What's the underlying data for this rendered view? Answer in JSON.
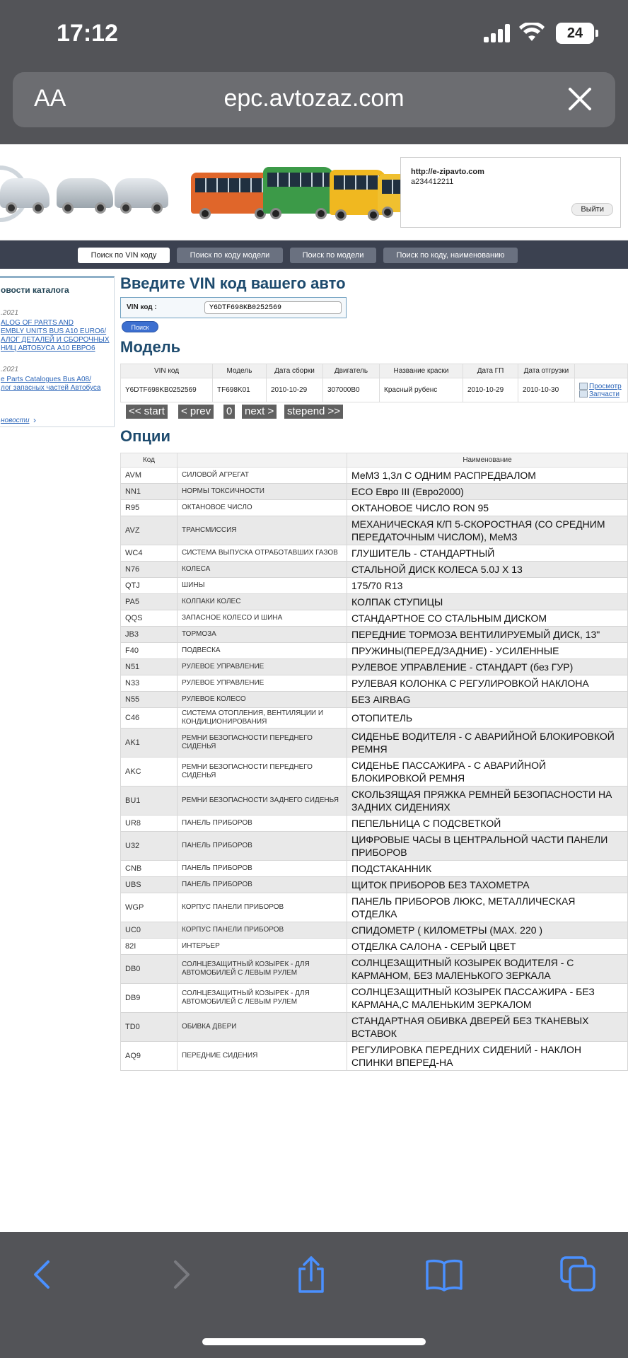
{
  "status": {
    "time": "17:12",
    "battery": "24"
  },
  "browser": {
    "aa": "AA",
    "url": "epc.avtozaz.com"
  },
  "banner": {
    "site": "http://e-zipavto.com",
    "user": "a234412211",
    "logout": "Выйти"
  },
  "nav": {
    "tabs": [
      "Поиск по VIN коду",
      "Поиск по коду модели",
      "Поиск по модели",
      "Поиск по коду, наименованию"
    ]
  },
  "sidebar": {
    "title": "овости каталога",
    "news": [
      {
        "date": ".2021",
        "lines": [
          "ALOG OF PARTS AND",
          "EMBLY UNITS BUS A10 EURO6/",
          "АЛОГ ДЕТАЛЕЙ И СБОРОЧНЫХ",
          "НИЦ АВТОБУСА А10 ЕВРО6"
        ]
      },
      {
        "date": ".2021",
        "lines": [
          "e Parts Catalogues Bus A08/",
          "лог запасных частей Автобуса"
        ]
      }
    ],
    "all_news": "новости"
  },
  "vin_section": {
    "title": "Введите VIN код вашего авто",
    "label": "VIN код :",
    "value": "Y6DTF698KB0252569",
    "search": "Поиск"
  },
  "model": {
    "title": "Модель",
    "headers": [
      "VIN код",
      "Модель",
      "Дата сборки",
      "Двигатель",
      "Название краски",
      "Дата ГП",
      "Дата отгрузки"
    ],
    "row": [
      "Y6DTF698KB0252569",
      "TF698K01",
      "2010-10-29",
      "307000B0",
      "Красный рубенс",
      "2010-10-29",
      "2010-10-30"
    ],
    "actions": [
      "Просмотр",
      "Запчасти"
    ]
  },
  "pager": {
    "start": "<< start",
    "prev": "< prev",
    "page": "0",
    "next": "next >",
    "end": "stepend >>"
  },
  "options": {
    "title": "Опции",
    "headers": [
      "Код",
      "",
      "Наименование"
    ],
    "rows": [
      [
        "AVM",
        "СИЛОВОЙ АГРЕГАТ",
        "МеМЗ 1,3л С ОДНИМ РАСПРЕДВАЛОМ"
      ],
      [
        "NN1",
        "НОРМЫ ТОКСИЧНОСТИ",
        "ECO Евро III (Евро2000)"
      ],
      [
        "R95",
        "ОКТАНОВОЕ ЧИСЛО",
        "ОКТАНОВОЕ ЧИСЛО RON 95"
      ],
      [
        "AVZ",
        "ТРАНСМИССИЯ",
        "МЕХАНИЧЕСКАЯ К/П 5-СКОРОСТНАЯ (СО СРЕДНИМ ПЕРЕДАТОЧНЫМ ЧИСЛОМ), МеМЗ"
      ],
      [
        "WC4",
        "СИСТЕМА ВЫПУСКА ОТРАБОТАВШИХ ГАЗОВ",
        "ГЛУШИТЕЛЬ - СТАНДАРТНЫЙ"
      ],
      [
        "N76",
        "КОЛЕСА",
        "СТАЛЬНОЙ ДИСК КОЛЕСА 5.0J X 13"
      ],
      [
        "QTJ",
        "ШИНЫ",
        "175/70 R13"
      ],
      [
        "PA5",
        "КОЛПАКИ КОЛЕС",
        "КОЛПАК СТУПИЦЫ"
      ],
      [
        "QQS",
        "ЗАПАСНОЕ КОЛЕСО И ШИНА",
        "СТАНДАРТНОЕ СО СТАЛЬНЫМ ДИСКОМ"
      ],
      [
        "JB3",
        "ТОРМОЗА",
        "ПЕРЕДНИЕ ТОРМОЗА ВЕНТИЛИРУЕМЫЙ ДИСК, 13\""
      ],
      [
        "F40",
        "ПОДВЕСКА",
        "ПРУЖИНЫ(ПЕРЕД/ЗАДНИЕ) - УСИЛЕННЫЕ"
      ],
      [
        "N51",
        "РУЛЕВОЕ УПРАВЛЕНИЕ",
        "РУЛЕВОЕ УПРАВЛЕНИЕ - СТАНДАРТ (без ГУР)"
      ],
      [
        "N33",
        "РУЛЕВОЕ УПРАВЛЕНИЕ",
        "РУЛЕВАЯ КОЛОНКА С РЕГУЛИРОВКОЙ НАКЛОНА"
      ],
      [
        "N55",
        "РУЛЕВОЕ КОЛЕСО",
        "БЕЗ AIRBAG"
      ],
      [
        "C46",
        "СИСТЕМА ОТОПЛЕНИЯ, ВЕНТИЛЯЦИИ И КОНДИЦИОНИРОВАНИЯ",
        "ОТОПИТЕЛЬ"
      ],
      [
        "AK1",
        "РЕМНИ БЕЗОПАСНОСТИ ПЕРЕДНЕГО СИДЕНЬЯ",
        "СИДЕНЬЕ ВОДИТЕЛЯ - С АВАРИЙНОЙ БЛОКИРОВКОЙ РЕМНЯ"
      ],
      [
        "AKC",
        "РЕМНИ БЕЗОПАСНОСТИ ПЕРЕДНЕГО СИДЕНЬЯ",
        "СИДЕНЬЕ ПАССАЖИРА - С АВАРИЙНОЙ БЛОКИРОВКОЙ РЕМНЯ"
      ],
      [
        "BU1",
        "РЕМНИ БЕЗОПАСНОСТИ ЗАДНЕГО СИДЕНЬЯ",
        "СКОЛЬЗЯЩАЯ ПРЯЖКА РЕМНЕЙ БЕЗОПАСНОСТИ НА ЗАДНИХ СИДЕНИЯХ"
      ],
      [
        "UR8",
        "ПАНЕЛЬ ПРИБОРОВ",
        "ПЕПЕЛЬНИЦА С ПОДСВЕТКОЙ"
      ],
      [
        "U32",
        "ПАНЕЛЬ ПРИБОРОВ",
        "ЦИФРОВЫЕ ЧАСЫ В ЦЕНТРАЛЬНОЙ ЧАСТИ ПАНЕЛИ ПРИБОРОВ"
      ],
      [
        "CNB",
        "ПАНЕЛЬ ПРИБОРОВ",
        "ПОДСТАКАННИК"
      ],
      [
        "UBS",
        "ПАНЕЛЬ ПРИБОРОВ",
        "ЩИТОК ПРИБОРОВ БЕЗ ТАХОМЕТРА"
      ],
      [
        "WGP",
        "КОРПУС ПАНЕЛИ ПРИБОРОВ",
        "ПАНЕЛЬ ПРИБОРОВ ЛЮКС, МЕТАЛЛИЧЕСКАЯ ОТДЕЛКА"
      ],
      [
        "UC0",
        "КОРПУС ПАНЕЛИ ПРИБОРОВ",
        "СПИДОМЕТР ( КИЛОМЕТРЫ (MAX. 220 )"
      ],
      [
        "82I",
        "ИНТЕРЬЕР",
        "ОТДЕЛКА САЛОНА - СЕРЫЙ ЦВЕТ"
      ],
      [
        "DB0",
        "СОЛНЦЕЗАЩИТНЫЙ КОЗЫРЕК - ДЛЯ АВТОМОБИЛЕЙ С ЛЕВЫМ РУЛЕМ",
        "СОЛНЦЕЗАЩИТНЫЙ КОЗЫРЕК ВОДИТЕЛЯ - С КАРМАНОМ, БЕЗ МАЛЕНЬКОГО ЗЕРКАЛА"
      ],
      [
        "DB9",
        "СОЛНЦЕЗАЩИТНЫЙ КОЗЫРЕК - ДЛЯ АВТОМОБИЛЕЙ С ЛЕВЫМ РУЛЕМ",
        "СОЛНЦЕЗАЩИТНЫЙ КОЗЫРЕК ПАССАЖИРА - БЕЗ КАРМАНА,С МАЛЕНЬКИМ ЗЕРКАЛОМ"
      ],
      [
        "TD0",
        "ОБИВКА ДВЕРИ",
        "СТАНДАРТНАЯ ОБИВКА ДВЕРЕЙ БЕЗ ТКАНЕВЫХ ВСТАВОК"
      ],
      [
        "AQ9",
        "ПЕРЕДНИЕ СИДЕНИЯ",
        "РЕГУЛИРОВКА ПЕРЕДНИХ СИДЕНИЙ - НАКЛОН СПИНКИ ВПЕРЕД-НА"
      ]
    ]
  },
  "colors": {
    "chrome": "#535458",
    "accent_blue": "#4a90ff",
    "heading": "#1e4b6e",
    "link": "#2a64b8"
  },
  "icons": [
    "back-icon",
    "forward-icon",
    "share-icon",
    "bookmarks-icon",
    "tabs-icon",
    "close-icon",
    "wifi-icon",
    "signal-icon"
  ]
}
